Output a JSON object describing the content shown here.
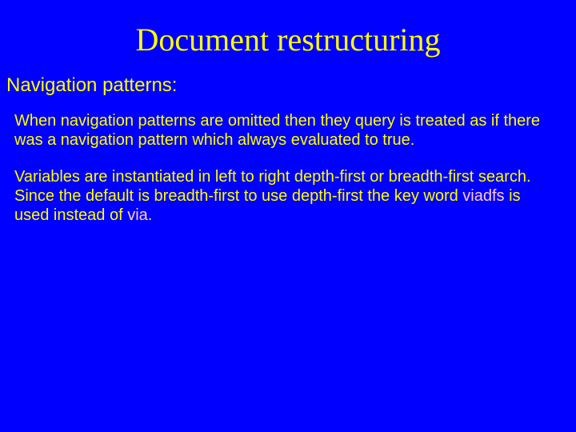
{
  "title": "Document restructuring",
  "subtitle": "Navigation patterns:",
  "para1": "When navigation patterns are omitted then they query is treated as if there was a navigation pattern which always evaluated to true.",
  "para2a": "Variables are instantiated in left to right depth-first or breadth-first search.  Since the default is breadth-first to use depth-first the key word ",
  "kw1": "viadfs",
  "para2b": " is used instead of ",
  "kw2": "via",
  "para2c": "."
}
